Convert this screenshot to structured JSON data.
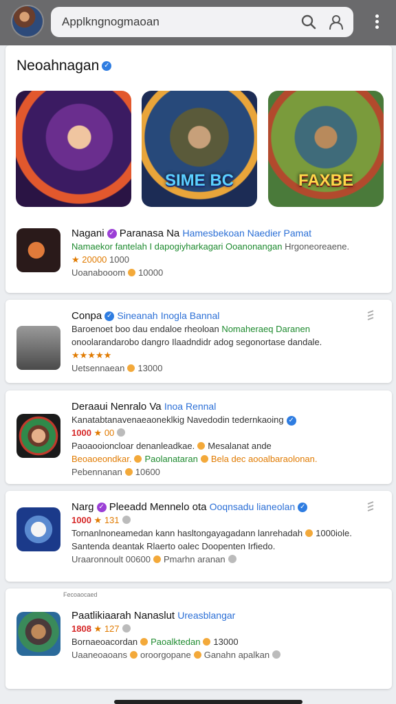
{
  "search": {
    "value": "Applkngnogmaoan"
  },
  "featured": {
    "title": "Neoahnagan",
    "banners": [
      {
        "label": ""
      },
      {
        "label": "SIME BC"
      },
      {
        "label": "FAXBE"
      }
    ]
  },
  "apps": [
    {
      "name": "Nagani",
      "developer": "Paranasa Na",
      "tagline": "Hamesbekoan Naedier Pamat",
      "line1": "Namaekor fantelah I dapogiyharkagari",
      "line1b": "Ooanonangan",
      "line1c": "Hrgoneoreaene.",
      "rating": "★ 20000",
      "rating_extra": "1000",
      "meta": "Uoanabooom",
      "meta_value": "10000"
    },
    {
      "name": "Conpa",
      "developer": "Sineanah",
      "tagline": "Inogla Bannal",
      "line1": "Baroenoet boo dau endaloe rheoloan",
      "line1b": "Nomaheraeq Daranen",
      "line2": "onoolarandarobo dangro Ilaadndidr adog segonortase dandale.",
      "rating": "★★★★★",
      "meta": "Uetsennaean",
      "meta_value": "13000"
    },
    {
      "name": "Deraaui Nenralo Va",
      "tagline": "Inoa Rennal",
      "line1": "Kanatabtanavenaeaoneklkig Navedodin tedernkaoing",
      "rating": "1000",
      "rating_extra": "★ 00",
      "line2": "Paoaooioncloar denanleadkae.",
      "line2b": "Mesalanat ande",
      "line3": "Beoaoeondkar.",
      "line3b": "Paolanataran",
      "line3c": "Bela dec aooalbaraolonan.",
      "meta": "Pebennanan",
      "meta_value": "10600"
    },
    {
      "name": "Narg",
      "developer": "Pleeadd Mennelo ota",
      "tagline": "Ooqnsadu lianeolan",
      "rating": "1000",
      "rating_extra": "★ 131",
      "line1": "Tornanlnoneamedan kann hasltongayagadann lanrehadah",
      "line1b": "1000iole.",
      "line2": "Santenda deantak Rlaerto oalec Doopenten Irfiedo.",
      "meta": "Uraaronnoult",
      "meta_value": "00600",
      "meta2": "Pmarhn aranan"
    },
    {
      "section": "Fecoaocaed",
      "name": "Paatlikiaarah Nanaslut",
      "tagline": "Ureasblangar",
      "rating": "1808",
      "rating_extra": "★ 127",
      "line1": "Bornaeoacordan",
      "line1b": "Paoalktedan",
      "line1c": "13000",
      "meta": "Uaaneoaoans",
      "meta_value": "oroorgopane",
      "meta2": "Ganahn apalkan"
    }
  ]
}
